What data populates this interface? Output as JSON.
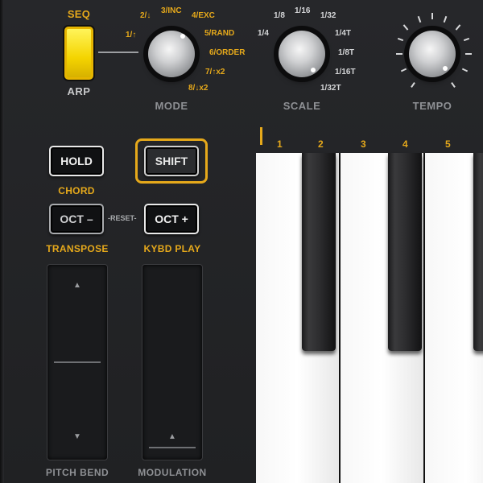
{
  "arp": {
    "seq_label": "SEQ",
    "arp_label": "ARP"
  },
  "mode": {
    "label": "MODE",
    "options": [
      "1/↑",
      "2/↓",
      "3/INC",
      "4/EXC",
      "5/RAND",
      "6/ORDER",
      "7/↑x2",
      "8/↓x2"
    ]
  },
  "scale": {
    "label": "SCALE",
    "options": [
      "1/4",
      "1/8",
      "1/16",
      "1/32",
      "1/4T",
      "1/8T",
      "1/16T",
      "1/32T"
    ]
  },
  "tempo": {
    "label": "TEMPO"
  },
  "buttons": {
    "hold": "HOLD",
    "shift": "SHIFT",
    "oct_minus": "OCT –",
    "oct_plus": "OCT +",
    "reset": "-RESET-"
  },
  "sublabels": {
    "chord": "CHORD",
    "transpose": "TRANSPOSE",
    "kybd_play": "KYBD PLAY"
  },
  "wheels": {
    "pitch_label": "PITCH BEND",
    "mod_label": "MODULATION",
    "up_arrow": "▲",
    "down_arrow": "▼"
  },
  "keyboard": {
    "numbers": [
      "1",
      "2",
      "3",
      "4",
      "5"
    ]
  },
  "colors": {
    "accent": "#e6a91b",
    "seq_button": "#f4d400",
    "panel": "#222326"
  }
}
